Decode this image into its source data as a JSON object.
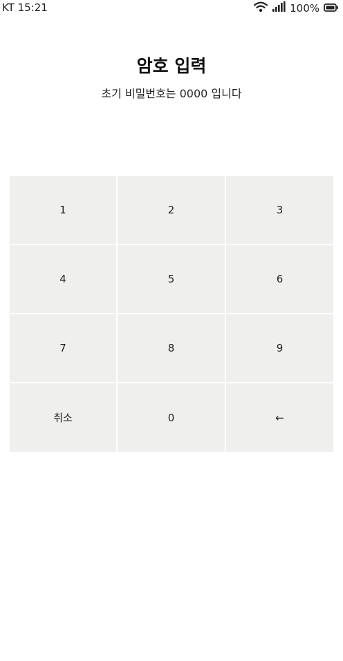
{
  "status_bar": {
    "carrier_time": "KT 15:21",
    "battery_percent": "100%",
    "icons": [
      "wifi-icon",
      "signal-icon",
      "battery-icon"
    ]
  },
  "header": {
    "title": "암호 입력",
    "subtitle": "초기 비밀번호는 0000 입니다"
  },
  "keypad": {
    "keys": [
      "1",
      "2",
      "3",
      "4",
      "5",
      "6",
      "7",
      "8",
      "9",
      "취소",
      "0",
      "←"
    ]
  },
  "colors": {
    "key_background": "#efefed",
    "background": "#ffffff",
    "text": "#111111"
  }
}
